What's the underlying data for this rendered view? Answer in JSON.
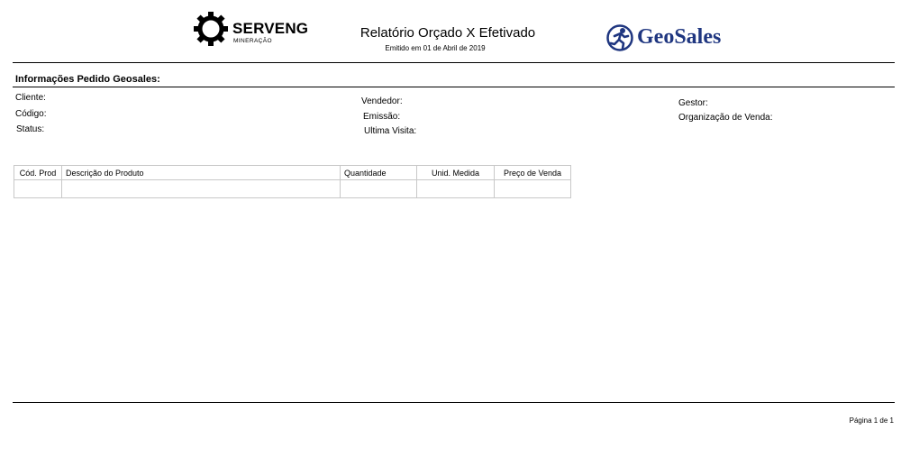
{
  "header": {
    "brand_left": {
      "name": "SERVENG",
      "subtitle": "MINERAÇÃO"
    },
    "title": "Relatório Orçado X Efetivado",
    "issued": "Emitido em 01 de Abril de 2019",
    "brand_right": {
      "name": "GeoSales",
      "color": "#1f3680"
    }
  },
  "section": {
    "title": "Informações Pedido Geosales:",
    "fields": {
      "cliente": "Cliente:",
      "codigo": "Código:",
      "status": "Status:",
      "vendedor": "Vendedor:",
      "emissao": "Emissão:",
      "ultima_visita": "Ultima Visita:",
      "gestor": "Gestor:",
      "organizacao": "Organização de Venda:"
    }
  },
  "table": {
    "headers": [
      "Cód. Prod",
      "Descrição do Produto",
      "Quantidade",
      "Unid. Medida",
      "Preço de Venda"
    ],
    "rows": [
      [
        "",
        "",
        "",
        "",
        ""
      ]
    ]
  },
  "footer": {
    "page": "Página 1 de 1"
  }
}
